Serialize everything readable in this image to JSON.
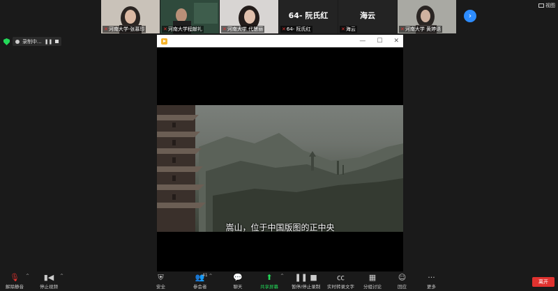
{
  "participants": [
    {
      "name": "河南大学-张慕珍",
      "type": "video",
      "muted": true
    },
    {
      "name": "河南大学程献礼",
      "type": "video",
      "muted": true
    },
    {
      "name": "河南大学 代慧丽",
      "type": "video",
      "muted": true
    },
    {
      "name": "64- 阮氏红",
      "type": "name",
      "display": "64- 阮氏红",
      "muted": true
    },
    {
      "name": "海云",
      "type": "name",
      "display": "海云",
      "muted": true
    },
    {
      "name": "河南大学 黄婷语",
      "type": "video",
      "muted": true
    }
  ],
  "view_label": "视图",
  "recording_label": "录制中...",
  "player": {
    "subtitle": "嵩山，位于中国版图的正中央"
  },
  "toolbar": {
    "unmute": "解除静音",
    "stop_video": "停止视频",
    "security": "安全",
    "participants": "参会者",
    "participants_count": "41",
    "chat": "聊天",
    "share": "共享屏幕",
    "pause_rec": "暂停/停止录制",
    "captions": "实时转录文字",
    "breakout": "分组讨论",
    "reactions": "回应",
    "more": "更多",
    "leave": "离开"
  },
  "colors": {
    "accent_green": "#23d959",
    "leave_red": "#e0322f",
    "next_blue": "#2d8cff"
  }
}
